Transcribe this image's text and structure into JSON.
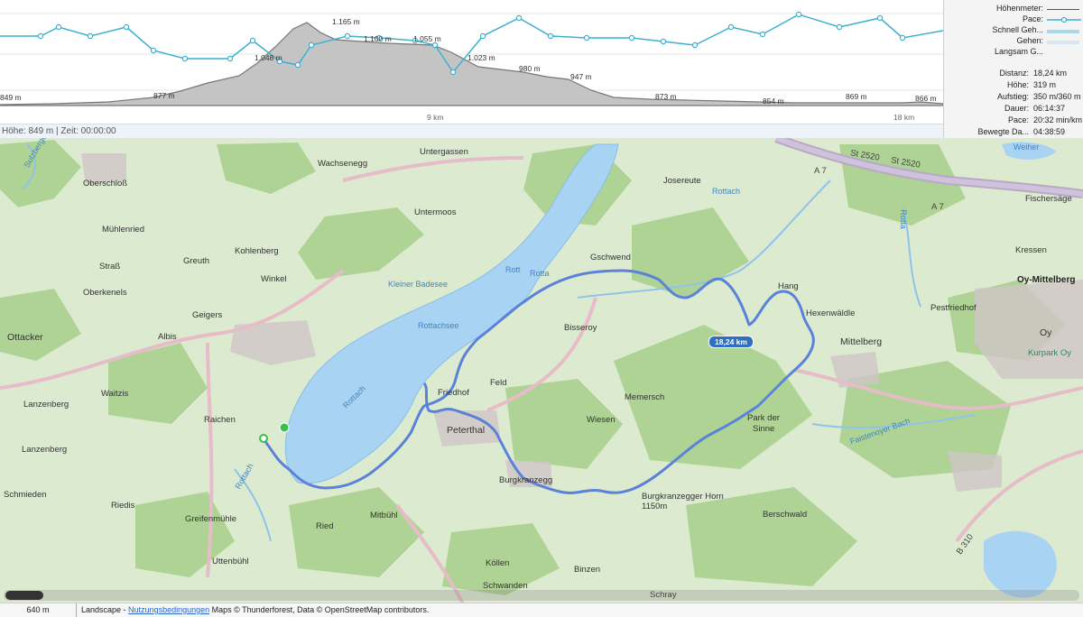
{
  "colors": {
    "route": "#5a82d8",
    "pace": "#3cb0d0",
    "water": "#a9d3f3",
    "land": "#dcead0",
    "forest": "#9fca84",
    "elevation_fill": "#b8b8b8",
    "elevation_line": "#7c7c7c",
    "badge": "#2f6fc1",
    "start_marker": "#36c24a"
  },
  "profile": {
    "peak_labels": [
      "1.165 m",
      "1.100 m",
      "1.055 m",
      "1.023 m",
      "980 m",
      "947 m",
      "1.048 m"
    ],
    "base_labels": [
      "849 m",
      "877 m",
      "873 m",
      "854 m",
      "869 m",
      "866 m"
    ],
    "distance_ticks": [
      "9 km",
      "18 km"
    ],
    "status": "Höhe: 849 m | Zeit: 00:00:00"
  },
  "legend": [
    {
      "label": "Höhenmeter:",
      "swatch": "elevation-line"
    },
    {
      "label": "Pace:",
      "swatch": "pace"
    },
    {
      "label": "Schnell Geh...",
      "swatch": "fast"
    },
    {
      "label": "Gehen:",
      "swatch": "walk"
    },
    {
      "label": "Langsam G...",
      "swatch": "slow"
    }
  ],
  "stats": [
    {
      "label": "Distanz:",
      "value": "18,24 km"
    },
    {
      "label": "Höhe:",
      "value": "319 m"
    },
    {
      "label": "Aufstieg:",
      "value": "350 m/360 m"
    },
    {
      "label": "Dauer:",
      "value": "06:14:37"
    },
    {
      "label": "Pace:",
      "value": "20:32 min/km"
    },
    {
      "label": "Bewegte Da...",
      "value": "04:38:59"
    }
  ],
  "map": {
    "distance_badge": "18,24 km",
    "place_labels": {
      "wachsenegg": "Wachsenegg",
      "untergassen": "Untergassen",
      "josereute": "Josereute",
      "oberschloss": "Oberschloß",
      "muehlenried": "Mühlenried",
      "untermoos": "Untermoos",
      "gschwend": "Gschwend",
      "kressen": "Kressen",
      "fischersage": "Fischersäge",
      "strass": "Straß",
      "greuth": "Greuth",
      "kohlenberg": "Kohlenberg",
      "oberkenels": "Oberkenels",
      "winkel": "Winkel",
      "geigers": "Geigers",
      "bisseroy": "Bisseroy",
      "hang": "Hang",
      "hexenwaldle": "Hexenwäldle",
      "pestfriedhof": "Pestfriedhof",
      "oy_mittelberg": "Oy-Mittelberg",
      "albis": "Albis",
      "ottacker": "Ottacker",
      "oy": "Oy",
      "kurpark": "Kurpark Oy",
      "mittelberg": "Mittelberg",
      "waitzis": "Waitzis",
      "lanzenberg1": "Lanzenberg",
      "feld": "Feld",
      "memersch": "Memersch",
      "friedhof": "Friedhof",
      "raichen": "Raichen",
      "wiesen": "Wiesen",
      "peterthal": "Peterthal",
      "park_der_sinne_1": "Park der",
      "park_der_sinne_2": "Sinne",
      "lanzenberg2": "Lanzenberg",
      "schmieden": "Schmieden",
      "burgkranzegg": "Burgkranzegg",
      "burgkranzegger_horn": "Burgkranzegger Horn",
      "horn_height": "1150m",
      "riedis": "Riedis",
      "greifenmuehle": "Greifenmühle",
      "ried": "Ried",
      "mitbuehl": "Mitbühl",
      "berschwald": "Berschwald",
      "uttenbuehl": "Uttenbühl",
      "koellen": "Köllen",
      "binzen": "Binzen",
      "schwanden": "Schwanden",
      "schray": "Schray"
    },
    "water_labels": {
      "kleiner_badesee": "Kleiner Badesee",
      "rottachsee": "Rottachsee",
      "rottach_lake": "Rottach",
      "rottach_n": "Rottach",
      "rott1": "Rott",
      "rott2": "Rotta",
      "rottach_sw": "Rottach",
      "weiher": "Weiher",
      "rotta_e": "Rotta",
      "faistenoyer": "Faistenoyer Bach",
      "sulzberger": "Sulzberger"
    },
    "road_labels": {
      "st2520a": "St 2520",
      "st2520b": "St 2520",
      "a7a": "A 7",
      "a7b": "A 7",
      "b310": "B 310"
    }
  },
  "footer": {
    "scale": "640 m",
    "attribution_prefix": "Landscape - ",
    "attribution_link": "Nutzungsbedingungen",
    "attribution_suffix": " Maps © Thunderforest, Data © OpenStreetMap contributors."
  }
}
